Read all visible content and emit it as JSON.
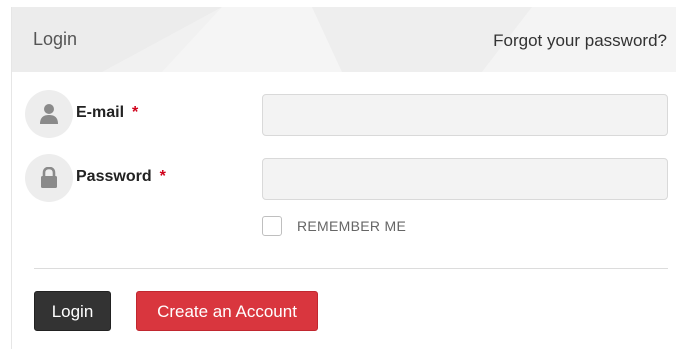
{
  "header": {
    "title": "Login",
    "forgot_link": "Forgot your password?"
  },
  "fields": [
    {
      "label": "E-mail",
      "required_mark": "*",
      "icon": "user-icon",
      "value": "",
      "placeholder": ""
    },
    {
      "label": "Password",
      "required_mark": "*",
      "icon": "lock-icon",
      "value": "",
      "placeholder": ""
    }
  ],
  "remember": {
    "label": "REMEMBER ME",
    "checked": false
  },
  "actions": {
    "login_label": "Login",
    "create_label": "Create an Account"
  },
  "colors": {
    "primary_button": "#333333",
    "secondary_button": "#d9363e",
    "required": "#d0021b"
  }
}
